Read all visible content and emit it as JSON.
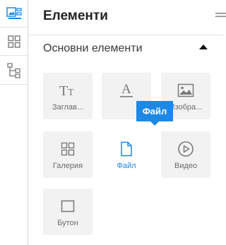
{
  "sidebar_rail": {
    "items": [
      {
        "icon": "image-layout-icon"
      },
      {
        "icon": "grid-icon"
      },
      {
        "icon": "sitemap-icon"
      }
    ]
  },
  "panel": {
    "title": "Елементи",
    "section_title": "Основни елементи",
    "elements": [
      {
        "label": "Заглав...",
        "icon": "text-style-icon"
      },
      {
        "label": "",
        "icon": "underline-a-icon"
      },
      {
        "label": "Изобра...",
        "icon": "image-icon"
      },
      {
        "label": "Галерия",
        "icon": "gallery-icon"
      },
      {
        "label": "Файл",
        "icon": "file-icon",
        "active": true
      },
      {
        "label": "Видео",
        "icon": "video-play-icon"
      },
      {
        "label": "Бутон",
        "icon": "button-icon"
      }
    ],
    "tooltip": "Файл"
  },
  "colors": {
    "accent": "#1e88e5",
    "tile_bg": "#f2f2f2",
    "icon_gray": "#777777"
  }
}
